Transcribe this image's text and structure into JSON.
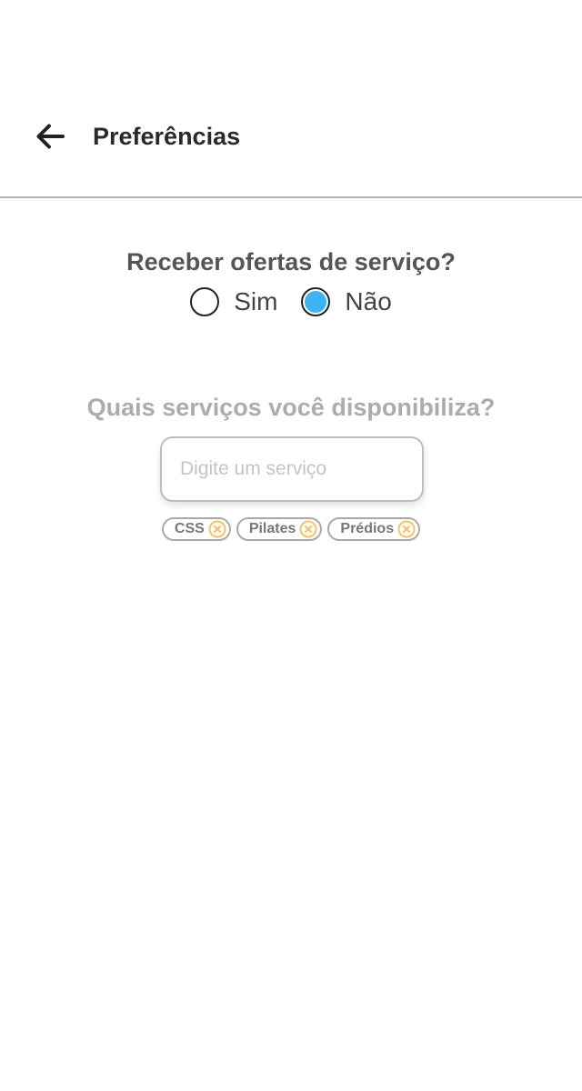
{
  "header": {
    "title": "Preferências",
    "back_icon": "arrow-left-icon"
  },
  "offers": {
    "question": "Receber ofertas de serviço?",
    "options": [
      {
        "label": "Sim",
        "selected": false
      },
      {
        "label": "Não",
        "selected": true
      }
    ]
  },
  "services": {
    "question": "Quais serviços você disponibiliza?",
    "input_placeholder": "Digite um serviço",
    "input_value": "",
    "tags": [
      {
        "label": "CSS",
        "remove_icon": "close-circle-icon"
      },
      {
        "label": "Pilates",
        "remove_icon": "close-circle-icon"
      },
      {
        "label": "Prédios",
        "remove_icon": "close-circle-icon"
      }
    ]
  },
  "colors": {
    "radio_selected": "#3db3f5",
    "tag_remove_icon": "#f5c26b",
    "divider": "#b5b5b5"
  }
}
